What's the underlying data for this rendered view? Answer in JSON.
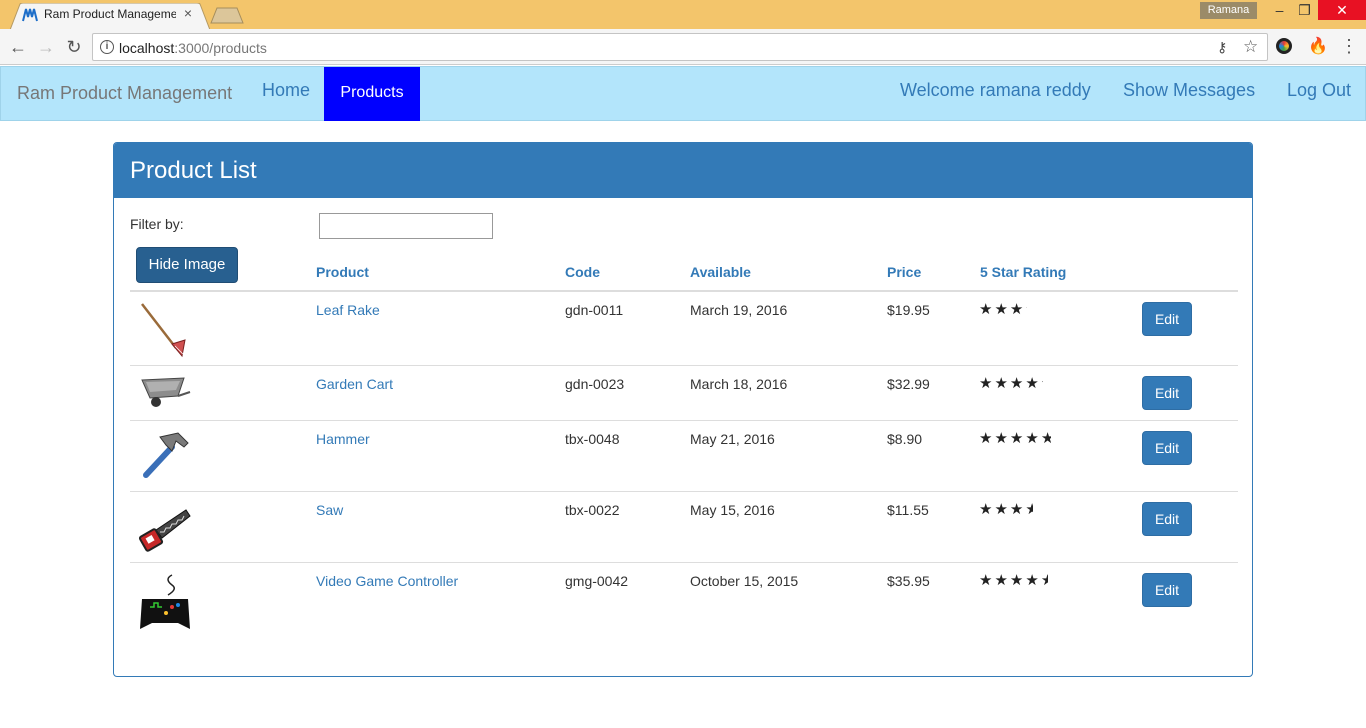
{
  "browser": {
    "tab_title": "Ram Product Manageme",
    "profile_name": "Ramana",
    "url_host": "localhost",
    "url_path": ":3000/products"
  },
  "navbar": {
    "brand": "Ram Product Management",
    "home": "Home",
    "products": "Products",
    "welcome": "Welcome ramana reddy",
    "messages": "Show Messages",
    "logout": "Log Out",
    "bg_color": "#b3e5fb",
    "active_color": "#0000ff"
  },
  "panel": {
    "title": "Product List",
    "filter_label": "Filter by:",
    "filter_value": "",
    "hide_image_label": "Hide Image",
    "accent_color": "#337ab7"
  },
  "columns": {
    "product": "Product",
    "code": "Code",
    "available": "Available",
    "price": "Price",
    "rating": "5 Star Rating"
  },
  "products": [
    {
      "name": "Leaf Rake",
      "code": "gdn-0011",
      "available": "March 19, 2016",
      "price": "$19.95",
      "rating": 3.2,
      "image_icon": "leaf-rake-icon",
      "edit_label": "Edit"
    },
    {
      "name": "Garden Cart",
      "code": "gdn-0023",
      "available": "March 18, 2016",
      "price": "$32.99",
      "rating": 4.2,
      "image_icon": "garden-cart-icon",
      "edit_label": "Edit"
    },
    {
      "name": "Hammer",
      "code": "tbx-0048",
      "available": "May 21, 2016",
      "price": "$8.90",
      "rating": 4.8,
      "image_icon": "hammer-icon",
      "edit_label": "Edit"
    },
    {
      "name": "Saw",
      "code": "tbx-0022",
      "available": "May 15, 2016",
      "price": "$11.55",
      "rating": 3.7,
      "image_icon": "saw-icon",
      "edit_label": "Edit"
    },
    {
      "name": "Video Game Controller",
      "code": "gmg-0042",
      "available": "October 15, 2015",
      "price": "$35.95",
      "rating": 4.6,
      "image_icon": "controller-icon",
      "edit_label": "Edit"
    }
  ]
}
